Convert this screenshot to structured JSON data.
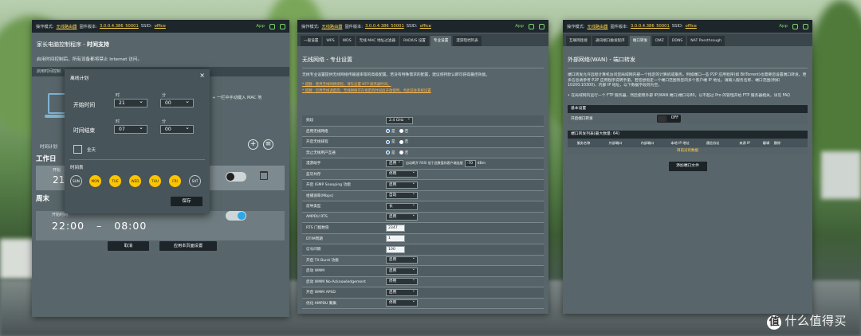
{
  "status_bar": {
    "mode_label": "操作模式:",
    "mode_value": "无线路由器",
    "firmware_label": "固件版本:",
    "firmware_value": "3.0.0.4.386_50001",
    "ssid_label": "SSID:",
    "ssid_value": "office",
    "app_label": "App"
  },
  "panel1": {
    "title_prefix": "家长电脑控制程序 - ",
    "title_bold": "时间支持",
    "desc": "启用时间控制后，所有设备都将禁止 Internet 访问。",
    "bar_text": "启用时间控制",
    "side_text": "+ 一栏中手动键入 MAC 地",
    "sched_label": "时间计划",
    "work_header": "工作日",
    "work_time": "21",
    "work_on": "开始",
    "week_header": "周末",
    "week_on": "开始时间",
    "week_time_start": "22:00",
    "week_time_sep": "–",
    "week_time_end": "08:00",
    "cancel_label": "取消",
    "apply_label": "应用本页面设置",
    "modal": {
      "title": "离线计划",
      "close": "×",
      "start_label": "开始时间",
      "end_label": "时间结束",
      "hour_label": "时",
      "minute_label": "分",
      "start_hour": "21",
      "start_minute": "00",
      "end_hour": "07",
      "end_minute": "00",
      "allday_label": "全天",
      "days_label": "时间表",
      "days": [
        {
          "label": "SUN",
          "on": false
        },
        {
          "label": "MON",
          "on": true
        },
        {
          "label": "TUE",
          "on": true
        },
        {
          "label": "WED",
          "on": true
        },
        {
          "label": "THU",
          "on": true
        },
        {
          "label": "FRI",
          "on": true
        },
        {
          "label": "SAT",
          "on": false
        }
      ],
      "save_label": "保存"
    }
  },
  "panel2": {
    "tabs": [
      "一般设置",
      "WPS",
      "WDS",
      "无线 MAC 地址过滤器",
      "RADIUS 设置",
      "专业设置",
      "漫游阻挡列表"
    ],
    "active_tab": 5,
    "title": "无线网络 - 专业设置",
    "desc": "无线专业设置提供无线网络传输速率等的高级配置。若没有特殊需求的配置，建议保持默认即可获得最佳效能。",
    "warn1": "* 提醒：使用无线网络排程，请先设置 NTP 服务器时间。",
    "warn2": "* 提醒：启用无线调度后，无线网络可在指定的时间段开放使用。点此前往系统设置",
    "rows": [
      {
        "label": "频段",
        "type": "select",
        "value": "2.4 GHz"
      },
      {
        "label": "启用无线网络",
        "type": "radio",
        "options": [
          "是",
          "否"
        ],
        "selected": 0
      },
      {
        "label": "开启无线排程",
        "type": "radio",
        "options": [
          "是",
          "否"
        ],
        "selected": 0
      },
      {
        "label": "禁止无线用户互通",
        "type": "radio",
        "options": [
          "是",
          "否"
        ],
        "selected": 0
      },
      {
        "label": "漫游助手",
        "type": "roam",
        "value": "启用",
        "note": "自动断开 RSSI 低于此数值的客户端连接",
        "rssi": "-70",
        "unit": "dBm"
      },
      {
        "label": "蓝牙共存",
        "type": "select",
        "value": "停用"
      },
      {
        "label": "开启 IGMP Snooping 功能",
        "type": "select",
        "value": "启用"
      },
      {
        "label": "组播速率(Mbps)",
        "type": "select",
        "value": "自动"
      },
      {
        "label": "前导类型",
        "type": "select",
        "value": "长"
      },
      {
        "label": "AMPDU RTS",
        "type": "select",
        "value": "启用"
      },
      {
        "label": "RTS 门槛数值",
        "type": "input",
        "value": "2347"
      },
      {
        "label": "DTIM周期",
        "type": "input",
        "value": "1"
      },
      {
        "label": "信号间隔",
        "type": "input",
        "value": "100"
      },
      {
        "label": "开启 TX Burst 功能",
        "type": "select",
        "value": "启用"
      },
      {
        "label": "启动 WMM",
        "type": "select",
        "value": "启用"
      },
      {
        "label": "启动 WMM No-Acknowledgement",
        "type": "select",
        "value": "停用"
      },
      {
        "label": "开启 WMM APSD",
        "type": "select",
        "value": "启用"
      },
      {
        "label": "优化 AMPDU 聚集",
        "type": "select",
        "value": "停用"
      }
    ]
  },
  "panel3": {
    "tabs": [
      "互联网连接",
      "通讯端口触发程序",
      "端口转发",
      "DMZ",
      "DDNS",
      "NAT Passthrough"
    ],
    "active_tab": 2,
    "title": "外部网络(WAN) - 端口转发",
    "desc": "端口转发允许远程计算机访问您局域网内部一个指定的计算机或服务。例如端口一些 P2P 应用程序(如 BitTorrent)也需要您设置端口转发。更多信息请参考 P2P 应用程序说明手册。若您想指定一个端口范围到您的多个客户端 IP 地址，请输入服务名称、端口范围(例如 10200:10300)、内部 IP 地址，以下数据字段则为空。",
    "bullet": "• 在局域网内运行一个 FTP 服务器，然后使用外部 IP(WAN 端口)端口号80，以不超过 Pro 的管理开始 FTP 服务器相关，详见 FAQ",
    "basic_header": "基本设置",
    "enable_label": "开启端口转发",
    "enable_value": "OFF",
    "list_header": "端口转发列表(最大数量: 64)",
    "columns": [
      "服务名称",
      "外部端口",
      "内部端口",
      "本地 IP 地址",
      "通信协议",
      "来源 IP",
      "编辑",
      "删除"
    ],
    "nodata": "目前没有数据",
    "add_label": "添加端口文件"
  },
  "watermark": {
    "badge": "值",
    "text": "什么值得买"
  }
}
